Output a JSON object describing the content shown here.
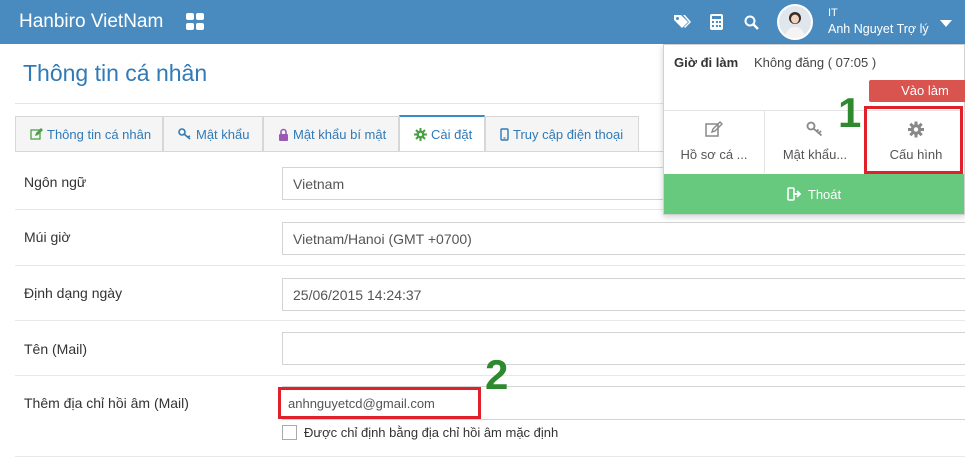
{
  "header": {
    "brand": "Hanbiro VietNam",
    "user_dept": "IT",
    "user_name": "Anh Nguyet Trợ lý",
    "icons": [
      "apps-grid-icon",
      "tag-icon",
      "calculator-icon",
      "search-icon",
      "chevron-down-icon"
    ]
  },
  "page": {
    "title": "Thông tin cá nhân"
  },
  "tabs": [
    {
      "label": "Thông tin cá nhân",
      "icon": "edit-icon",
      "active": false
    },
    {
      "label": "Mật khẩu",
      "icon": "key-icon",
      "active": false
    },
    {
      "label": "Mật khẩu bí mật",
      "icon": "lock-icon",
      "active": false
    },
    {
      "label": "Cài đặt",
      "icon": "gear-icon",
      "active": true
    },
    {
      "label": "Truy cập điện thoại",
      "icon": "mobile-icon",
      "active": false
    }
  ],
  "form": {
    "rows": [
      {
        "label": "Ngôn ngữ",
        "value": "Vietnam"
      },
      {
        "label": "Múi giờ",
        "value": "Vietnam/Hanoi (GMT +0700)"
      },
      {
        "label": "Định dạng ngày",
        "value": "25/06/2015 14:24:37"
      },
      {
        "label": "Tên (Mail)",
        "value": ""
      },
      {
        "label": "Thêm địa chỉ hồi âm (Mail)",
        "value": "anhnguyetcd@gmail.com"
      }
    ],
    "checkbox_label": "Được chỉ định bằng địa chỉ hồi âm mặc định",
    "checkbox_checked": false
  },
  "dropdown": {
    "work_label": "Giờ đi làm",
    "work_status": "Không đăng ( 07:05 )",
    "checkin_button": "Vào làm",
    "items": [
      {
        "label": "Hồ sơ cá ...",
        "icon": "edit-icon"
      },
      {
        "label": "Mật khẩu...",
        "icon": "key-icon"
      },
      {
        "label": "Cấu hình",
        "icon": "gear-icon"
      }
    ],
    "logout": "Thoát"
  },
  "markers": {
    "one": "1",
    "two": "2"
  },
  "colors": {
    "topbar": "#4a8bbf",
    "title": "#2f7ab7",
    "checkin": "#d9534f",
    "logout": "#66c97d",
    "highlight": "#e0212b",
    "marker": "#2e8a2e"
  }
}
